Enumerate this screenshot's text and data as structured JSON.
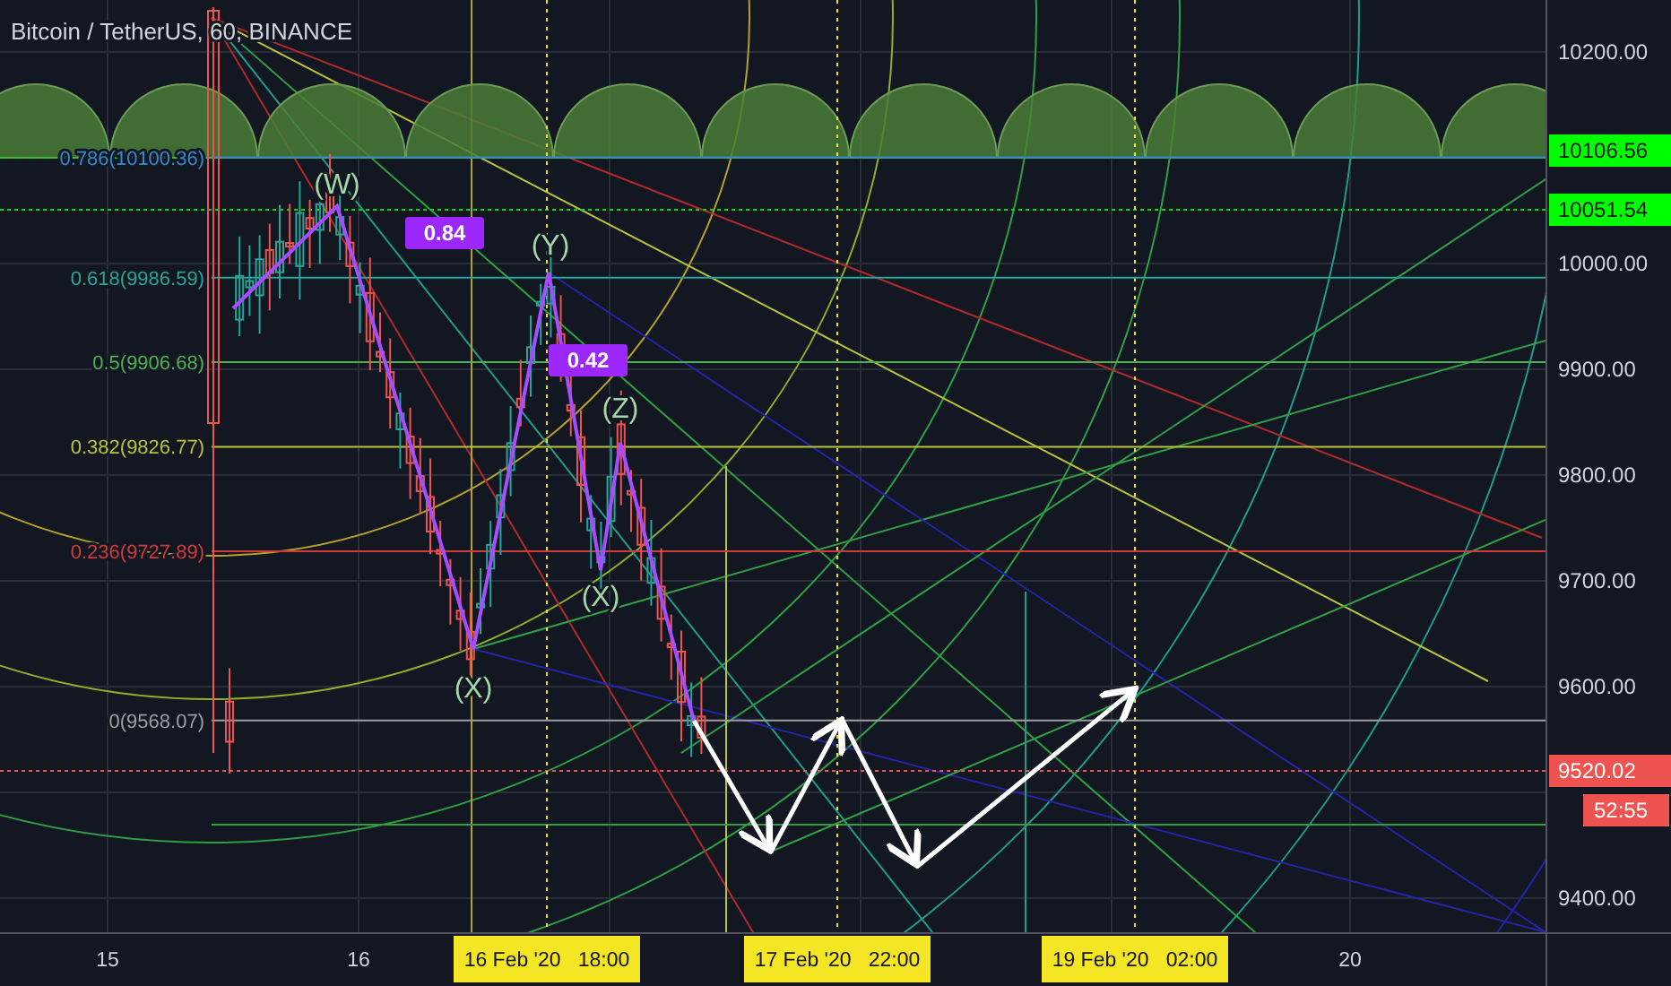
{
  "chart": {
    "title": "Bitcoin / TetherUS, 60, BINANCE",
    "fib_levels": [
      {
        "label": "0.786(10100.36)",
        "color": "#2e8bc9"
      },
      {
        "label": "0.618(9986.59)",
        "color": "#26a69a"
      },
      {
        "label": "0.5(9906.68)",
        "color": "#4caf50"
      },
      {
        "label": "0.382(9826.77)",
        "color": "#b9c23a"
      },
      {
        "label": "0.236(9727.89)",
        "color": "#d03a3a"
      },
      {
        "label": "0(9568.07)",
        "color": "#9e9e9e"
      }
    ],
    "wave_labels": [
      "(W)",
      "(Y)",
      "(Z)",
      "(X)",
      "(X)"
    ],
    "ratio_badges": [
      "0.84",
      "0.42"
    ],
    "price_axis": [
      {
        "label": "10200.00",
        "kind": "tick"
      },
      {
        "label": "10106.56",
        "kind": "level"
      },
      {
        "label": "10051.54",
        "kind": "level"
      },
      {
        "label": "10000.00",
        "kind": "tick"
      },
      {
        "label": "9900.00",
        "kind": "tick"
      },
      {
        "label": "9800.00",
        "kind": "tick"
      },
      {
        "label": "9700.00",
        "kind": "tick"
      },
      {
        "label": "9600.00",
        "kind": "tick"
      },
      {
        "label": "9520.02",
        "kind": "last"
      },
      {
        "label": "52:55",
        "kind": "countdown"
      },
      {
        "label": "9400.00",
        "kind": "tick"
      }
    ],
    "time_axis": [
      {
        "label": "15",
        "highlighted": false
      },
      {
        "label": "16",
        "highlighted": false
      },
      {
        "label": "16 Feb '20   18:00",
        "highlighted": true
      },
      {
        "label": "17 Feb '20   22:00",
        "highlighted": true
      },
      {
        "label": "19 Feb '20   02:00",
        "highlighted": true
      },
      {
        "label": "20",
        "highlighted": false
      }
    ]
  }
}
